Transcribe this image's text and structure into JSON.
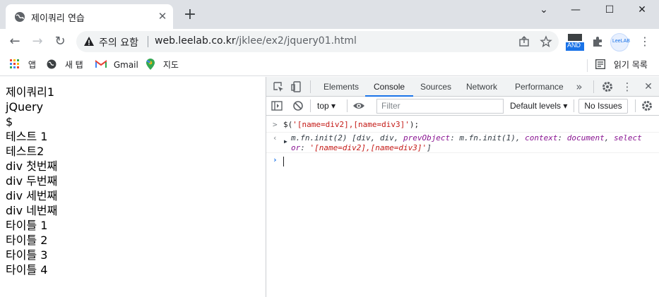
{
  "tab": {
    "title": "제이쿼리 연습",
    "close": "✕",
    "new": "+"
  },
  "window": {
    "minimize": "⌄",
    "min": "—",
    "max": "☐",
    "close": "✕"
  },
  "nav": {
    "back": "←",
    "forward": "→",
    "reload": "↻"
  },
  "omnibox": {
    "security_label": "주의 요함",
    "host": "web.leelab.co.kr",
    "path": "/jklee/ex2/jquery01.html"
  },
  "extensions": {
    "and_label": "AND",
    "leelab_label": "LeeLAB"
  },
  "bookmarks": {
    "apps": "앱",
    "news": "새 탭",
    "gmail": "Gmail",
    "maps": "지도",
    "reading_list": "읽기 목록"
  },
  "page": {
    "lines": [
      "제이쿼리1",
      "jQuery",
      "$",
      "테스트 1",
      "테스트2",
      "div 첫번째",
      "div 두번째",
      "div 세번째",
      "div 네번째",
      "타이틀 1",
      "타이틀 2",
      "타이틀 3",
      "타이틀 4"
    ]
  },
  "devtools": {
    "tabs": [
      "Elements",
      "Console",
      "Sources",
      "Network",
      "Performance"
    ],
    "more": "»",
    "context": "top",
    "filter_placeholder": "Filter",
    "levels": "Default levels",
    "issues": "No Issues",
    "console": {
      "input_prefix": "$(",
      "input_str": "'[name=div2],[name=div3]'",
      "input_suffix": ");",
      "out_head": "m.fn.init(2) [div, div, ",
      "out_key1": "prevObject",
      "out_mid1": ": m.fn.init(1), ",
      "out_key2": "context",
      "out_mid2": ": ",
      "out_ctx": "document",
      "out_mid3": ", ",
      "out_key3a": "select",
      "out_key3b": "or",
      "out_mid4": ": ",
      "out_str": "'[name=div2],[name=div3]'",
      "out_end": "]"
    }
  }
}
